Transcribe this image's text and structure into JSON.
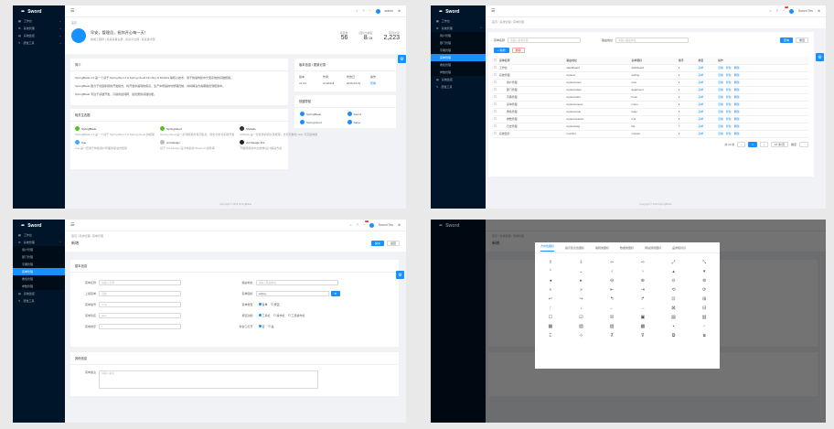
{
  "app": {
    "name": "Sword",
    "user": "admin",
    "user_alt": "Sword Tes",
    "badge": "37",
    "footer": "Copyright © 2019 SpringBlade"
  },
  "menu": {
    "top": [
      {
        "label": "工作台"
      },
      {
        "label": "系统管理"
      },
      {
        "label": "系统监控"
      },
      {
        "label": "研发工具"
      }
    ],
    "children": [
      {
        "label": "用户管理"
      },
      {
        "label": "部门管理"
      },
      {
        "label": "字典管理"
      },
      {
        "label": "菜单管理"
      },
      {
        "label": "角色管理"
      },
      {
        "label": "参数管理"
      }
    ],
    "bottom": [
      {
        "label": "系统监控"
      },
      {
        "label": "研发工具"
      }
    ]
  },
  "dashboard": {
    "crumb": "首页",
    "greeting": "早安，管理员，祝你开心每一天！",
    "greeting_sub": "前端工程师 | 某某某事业群 - 某某平台部 - 某某技术部",
    "stats": [
      {
        "label": "项目数",
        "value": "56"
      },
      {
        "label": "团队内排名",
        "value": "8",
        "suffix": "/ 24"
      },
      {
        "label": "项目访问",
        "value": "2,223"
      }
    ],
    "intro_title": "简介",
    "intro_lines": [
      "SpringBlade 2.0 是一个基于 Spring Boot 2 & Spring Cloud Finchley & Mybatis 等核心技术，用于快速构建中大型系统的基础框架。",
      "SpringBlade 致力于创造新颖的开发模式，将开发中遇到的痛点、生产中所踩的坑整理归纳，并将解决方案都融合到框架中。",
      "SpringBlade 专注于基础开发，只提供最纯粹、最优质的基础功能。"
    ],
    "ecosystem_title": "相关生态圈",
    "ecosystem": [
      {
        "name": "SpringBlade",
        "desc": "SpringBlade 2.0 是一个基于 Spring Boot 2 & Spring Cloud 的框架"
      },
      {
        "name": "SpringCloud",
        "desc": "Spring Cloud 是一系列框架的有序集合，简化分布式系统开发"
      },
      {
        "name": "Mybatis",
        "desc": "MyBatis 是一款优秀的持久层框架，支持定制化 SQL 与高级映射"
      },
      {
        "name": "Vue",
        "desc": "Vue 是一套用于构建用户界面的渐进式框架"
      },
      {
        "name": "Ant Design",
        "desc": "基于 Ant Design 设计体系的 React UI 组件库"
      },
      {
        "name": "Ant Design Pro",
        "desc": "开箱即用的中台前端/设计解决方案"
      }
    ],
    "version_title": "版本信息 / 更新记录",
    "version_head": [
      "版本",
      "作者",
      "修改日",
      "操作"
    ],
    "version_row": [
      "v2.0.0",
      "smallchill",
      "2019-03-01",
      "查看"
    ],
    "links_title": "快捷导航",
    "links": [
      "SpringBlade",
      "Sword",
      "SpringCloud",
      "Saber"
    ]
  },
  "table_page": {
    "crumb": "首页 / 系统管理 / 菜单管理",
    "filter_label1": "菜单名称",
    "filter_ph1": "请输入菜单名称",
    "filter_label2": "路由地址",
    "filter_ph2": "请输入路由地址",
    "query": "查询",
    "reset": "重置",
    "add": "+ 新增",
    "delete": "删除",
    "columns": [
      "菜单名称",
      "路由地址",
      "菜单图标",
      "排序",
      "类型",
      "操作"
    ],
    "rows": [
      {
        "name": "工作台",
        "path": "/dashboard",
        "icon": "dashboard",
        "sort": "1",
        "type": "菜单"
      },
      {
        "name": "系统管理",
        "path": "/system",
        "icon": "setting",
        "sort": "2",
        "type": "菜单"
      },
      {
        "name": "用户管理",
        "path": "/system/user",
        "icon": "user",
        "sort": "1",
        "type": "菜单"
      },
      {
        "name": "部门管理",
        "path": "/system/dept",
        "icon": "apartment",
        "sort": "2",
        "type": "菜单"
      },
      {
        "name": "字典管理",
        "path": "/system/dict",
        "icon": "book",
        "sort": "3",
        "type": "菜单"
      },
      {
        "name": "菜单管理",
        "path": "/system/menu",
        "icon": "menu",
        "sort": "4",
        "type": "菜单"
      },
      {
        "name": "角色管理",
        "path": "/system/role",
        "icon": "team",
        "sort": "5",
        "type": "菜单"
      },
      {
        "name": "参数管理",
        "path": "/system/param",
        "icon": "tool",
        "sort": "6",
        "type": "菜单"
      },
      {
        "name": "日志管理",
        "path": "/system/log",
        "icon": "file",
        "sort": "7",
        "type": "菜单"
      },
      {
        "name": "系统监控",
        "path": "/monitor",
        "icon": "monitor",
        "sort": "3",
        "type": "菜单"
      }
    ],
    "actions": [
      "查看",
      "修改",
      "删除"
    ],
    "pager": {
      "total": "共 10 条",
      "page": "1",
      "size": "10 条/页",
      "goto": "跳至"
    }
  },
  "form_page": {
    "crumb": "首页 / 系统管理 / 菜单管理",
    "title": "新增",
    "btn_submit": "提交",
    "btn_back": "返回",
    "section1": "基本信息",
    "left_fields": [
      {
        "label": "菜单名称",
        "value": "请输入名称"
      },
      {
        "label": "上级菜单",
        "value": "顶级"
      },
      {
        "label": "菜单编号",
        "value": "code"
      },
      {
        "label": "菜单别名",
        "value": "alias"
      },
      {
        "label": "菜单排序",
        "value": "1"
      }
    ],
    "right_labels": [
      "路由地址",
      "菜单图标",
      "菜单类型",
      "按钮功能",
      "新窗口打开"
    ],
    "route_ph": "请输入路由地址",
    "icon_value": "setting",
    "type_options": [
      "菜单",
      "按钮"
    ],
    "action_options": [
      "工具栏",
      "操作栏",
      "工具操作栏"
    ],
    "open_options": [
      "否",
      "是"
    ],
    "section2": "其他信息",
    "remark_label": "菜单备注",
    "remark_ph": "请输入备注"
  },
  "icon_modal": {
    "tabs": [
      "方向性图标",
      "提示建议性图标",
      "编辑类图标",
      "数据类图标",
      "网站通用图标",
      "品牌和标识"
    ],
    "icons": [
      "⇧",
      "⇩",
      "⇦",
      "⇨",
      "⤢",
      "⤡",
      "⌃",
      "⌄",
      "‹",
      "›",
      "▴",
      "▾",
      "◂",
      "▸",
      "⊖",
      "⊕",
      "⊙",
      "⊚",
      "«",
      "»",
      "⇤",
      "⇥",
      "⟲",
      "⟳",
      "↩",
      "↪",
      "↰",
      "↱",
      "⊡",
      "⊞",
      "↑",
      "↓",
      "←",
      "→",
      "⊠",
      "⊟",
      "☐",
      "☑",
      "☒",
      "▣",
      "▤",
      "▥",
      "▦",
      "▧",
      "▨",
      "▩",
      "▪",
      "▫",
      "⌶",
      "⊹",
      "⊼",
      "⊽",
      "⧉",
      "⧈"
    ]
  }
}
